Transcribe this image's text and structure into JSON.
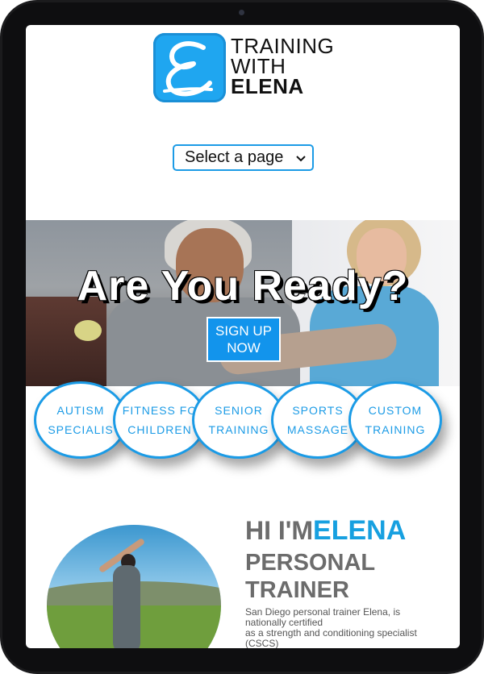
{
  "logo": {
    "letter": "E",
    "line1": "TRAINING",
    "line2": "WITH",
    "line3": "ELENA"
  },
  "nav": {
    "select_label": "Select a page"
  },
  "hero": {
    "title": "Are You Ready?",
    "button_line1": "SIGN UP",
    "button_line2": "NOW"
  },
  "services": [
    {
      "line1": "AUTISM",
      "line2": "SPECIALIS"
    },
    {
      "line1": "FITNESS FO",
      "line2": "CHILDREN"
    },
    {
      "line1": "SENIOR",
      "line2": "TRAINING"
    },
    {
      "line1": "SPORTS",
      "line2": "MASSAGE"
    },
    {
      "line1": "CUSTOM",
      "line2": "TRAINING"
    }
  ],
  "about": {
    "greeting": "HI I'M",
    "name": "ELENA",
    "role_line1": "PERSONAL",
    "role_line2": "TRAINER",
    "bio_line1": "San Diego personal trainer Elena, is",
    "bio_line2": "nationally certified",
    "bio_line3": "as a strength and conditioning specialist",
    "bio_line4": "(CSCS)"
  },
  "colors": {
    "accent": "#1b9be6",
    "heading_gray": "#6c6c6c",
    "device_frame": "#1b1b1d"
  }
}
